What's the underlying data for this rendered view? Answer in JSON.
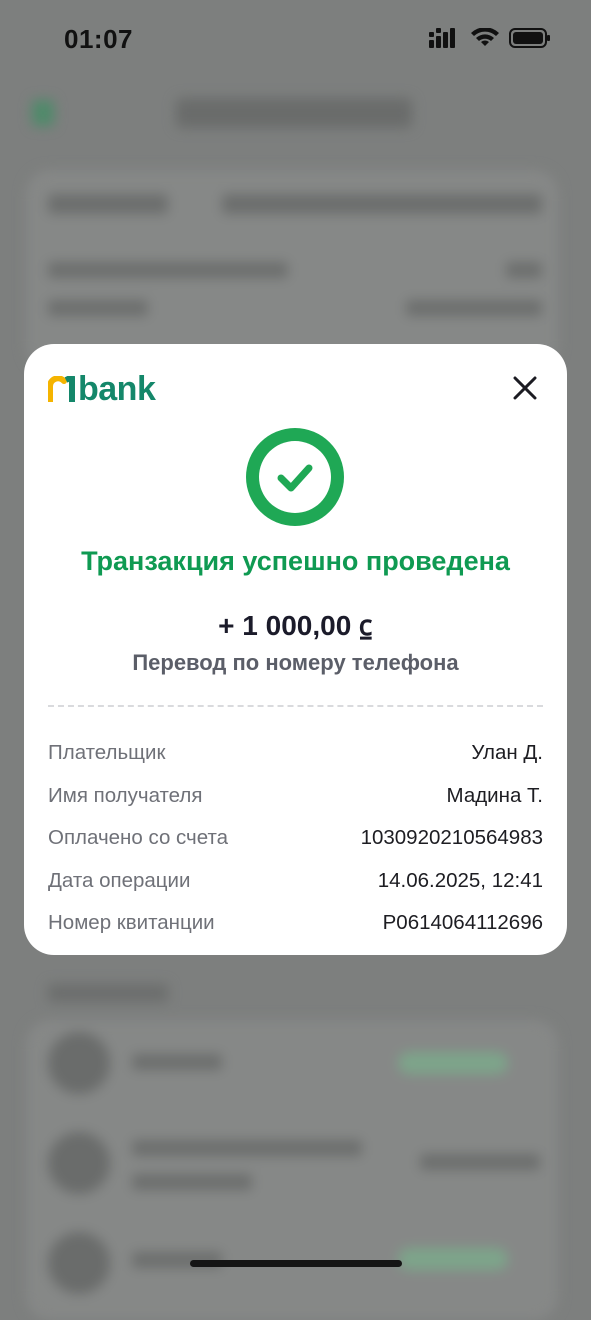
{
  "status_bar": {
    "time": "01:07"
  },
  "modal": {
    "logo_text": "bank",
    "headline": "Транзакция успешно проведена",
    "amount": "+ 1 000,00 ⃀",
    "subtitle": "Перевод по номеру телефона",
    "details": [
      {
        "label": "Плательщик",
        "value": "Улан Д."
      },
      {
        "label": "Имя получателя",
        "value": "Мадина Т."
      },
      {
        "label": "Оплачено со счета",
        "value": "1030920210564983"
      },
      {
        "label": "Дата операции",
        "value": "14.06.2025, 12:41"
      },
      {
        "label": "Номер квитанции",
        "value": "P0614064112696"
      }
    ]
  },
  "colors": {
    "brand_green": "#14876a",
    "logo_yellow": "#f5b400",
    "success_green": "#0f9a52",
    "overlay": "#7d7f7e"
  }
}
